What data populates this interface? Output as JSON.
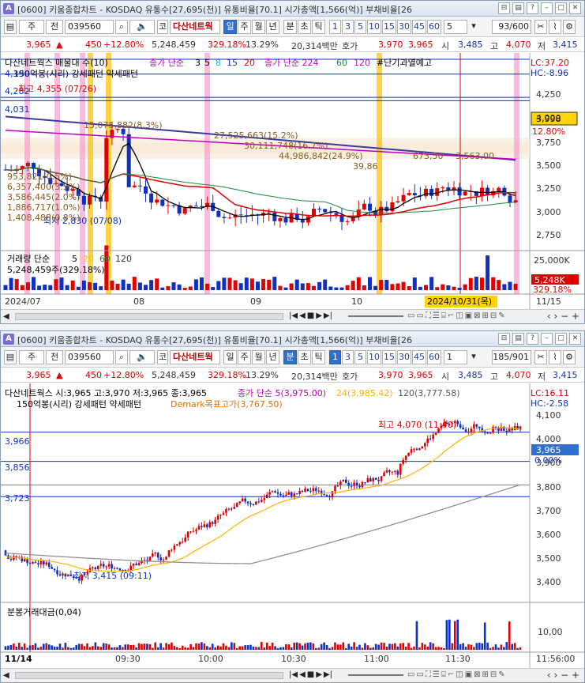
{
  "window1": {
    "title": "[0600] 키움종합차트 - KOSDAQ 유통수[27,695(천)] 유통비율[70.1] 시가총액[1,566(억)] 부채비율[26",
    "toolbar": {
      "menu1": "주",
      "menu2": "전",
      "code": "039560",
      "market": "코",
      "name": "다산네트웍",
      "periods": [
        "일",
        "주",
        "월",
        "년",
        "분",
        "초",
        "틱"
      ],
      "active_period": "일",
      "nums": [
        "1",
        "3",
        "5",
        "10",
        "15",
        "30",
        "45",
        "60"
      ],
      "sel": "5",
      "counter": "93",
      "counter_total": "/600"
    },
    "legend": {
      "name": "다산네트웍스 매물대 수(10)",
      "ma_label": "종가 단순",
      "ma_vals": [
        "3",
        "5",
        "8",
        "15",
        "20"
      ],
      "ma2_label": "종가 단순 224",
      "ma2_vals": [
        "60",
        "120"
      ],
      "tag": "#단기과열예고",
      "pattern_row": "150억봉(시리) 강세패턴 약세패턴",
      "lc": "LC:37.20",
      "hc": "HC:-8.96"
    },
    "annotations": {
      "high": "최고 4,355 (07/26)",
      "low": "최저 2,830 (07/08)",
      "price_a": "4,390",
      "price_b": "4,282",
      "price_c": "4,031",
      "vp1": "27,525,663(15.2%)",
      "vp2": "30,111,748(16.7%)",
      "vp3": "44,986,842(24.9%)",
      "vp4": "15,075,882(8,3%)",
      "vp5": "39,86",
      "vp6": "673,50",
      "vp7": "3,563,00",
      "vp8": "953,821(0.5%)",
      "vp9": "6,357,400(3.5%)",
      "vp10": "3,586,445(2.0%)",
      "vp11": "1,886,717(1.0%)",
      "vp12": "1,408,488(0.8%)",
      "current": "3,998",
      "pct": "12.80%"
    },
    "y_ticks": [
      "4,250",
      "4,000",
      "3,750",
      "3,500",
      "3,250",
      "3,000",
      "2,750"
    ],
    "volume": {
      "label": "거래량 단순",
      "vals": [
        "5",
        "20",
        "60",
        "120"
      ],
      "info": "5,248,459주(329.18%)",
      "scale": "25,000K",
      "current": "5,248K",
      "pct": "329.18%"
    },
    "x_labels": [
      "2024/07",
      "08",
      "09",
      "10",
      "11/15"
    ],
    "date_box": "2024/10/31(목)"
  },
  "window2": {
    "title": "[0600] 키움종합차트 - KOSDAQ 유통수[27,695(천)] 유통비율[70.1] 시가총액[1,566(억)] 부채비율[26",
    "toolbar": {
      "menu1": "주",
      "menu2": "전",
      "code": "039560",
      "market": "코",
      "name": "다산네트웍",
      "periods": [
        "일",
        "주",
        "월",
        "년",
        "분",
        "초",
        "틱"
      ],
      "active_period": "분",
      "nums": [
        "1",
        "3",
        "5",
        "10",
        "15",
        "30",
        "45",
        "60"
      ],
      "sel": "1",
      "counter": "185",
      "counter_total": "/901"
    },
    "legend": {
      "line1": "다산네트웍스 시:3,965 고:3,970 저:3,965 종:3,965",
      "ma_label": "종가 단순 5(3,975.00)",
      "ma_b": "24(3,985.42)",
      "ma_c": "120(3,777.58)",
      "pattern_row": "150억봉(시리) 강세패턴 약세패턴",
      "demark": "Demark목표고가(3,767.50)",
      "lc": "LC:16.11",
      "hc": "HC:-2.58"
    },
    "annotations": {
      "high": "최고 4,070 (11:40)",
      "low": "최저 3,415 (09:11)",
      "price_a": "3,966",
      "price_b": "3,856",
      "price_c": "3,723",
      "current": "3,965",
      "pct": "0.00%"
    },
    "y_ticks": [
      "4,100",
      "4,000",
      "3,900",
      "3,800",
      "3,700",
      "3,600",
      "3,500",
      "3,400"
    ],
    "volume": {
      "label": "분봉거래대금(0,04)",
      "scale": "10,00"
    },
    "x_labels": [
      "11/14",
      "09:30",
      "10:00",
      "10:30",
      "11:00",
      "11:30",
      "11:56:00"
    ]
  },
  "quote": {
    "price": "3,965",
    "arrow": "▲",
    "change": "450",
    "rate": "+12.80%",
    "volume": "5,248,459",
    "vol_rate": "329.18%",
    "turnover": "13.29%",
    "amount": "20,314백만",
    "hoga_label": "호가",
    "ask": "3,970",
    "bid": "3,965",
    "open_label": "시",
    "open": "3,485",
    "high_label": "고",
    "high": "4,070",
    "close_label": "저",
    "low": "3,415"
  },
  "chart_data": [
    {
      "type": "candlestick",
      "note": "daily chart",
      "y_range": [
        2600,
        4450
      ],
      "x_labels": [
        "2024/07",
        "08",
        "09",
        "10",
        "11/15"
      ]
    },
    {
      "type": "candlestick",
      "note": "1-minute chart",
      "y_range": [
        3330,
        4150
      ],
      "x_labels": [
        "11/14",
        "09:30",
        "10:00",
        "10:30",
        "11:00",
        "11:30",
        "11:56:00"
      ]
    }
  ],
  "colors": {
    "up": "#e00000",
    "down": "#1030c0",
    "ma5": "#000000",
    "ma20": "#e00000",
    "ma60": "#1a8a3a",
    "ma120": "#c000c0",
    "ma224": "#3a3aa0",
    "accent": "#2f6fd0",
    "gold": "#ffc000",
    "pink": "#ff9ad0"
  }
}
